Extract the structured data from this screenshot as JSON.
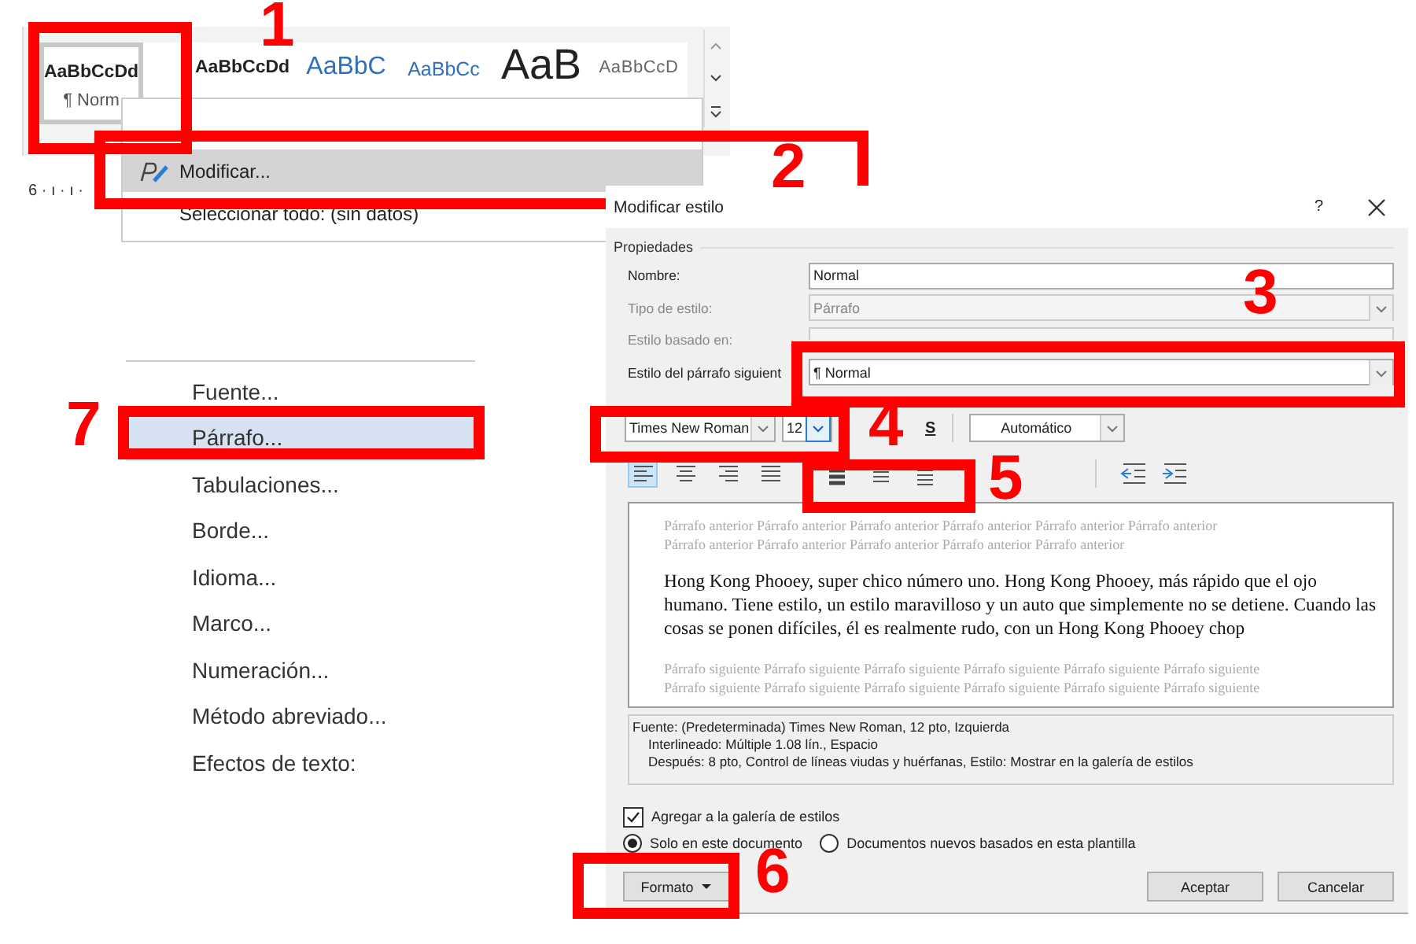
{
  "ribbon": {
    "styles": [
      {
        "preview": "AaBbCcDd",
        "kind": "normal",
        "selected": true,
        "label": "¶ Norm"
      },
      {
        "preview": "AaBbCcDd",
        "kind": "normal",
        "selected": false
      },
      {
        "preview": "AaBbC",
        "kind": "heading1",
        "selected": false
      },
      {
        "preview": "AaBbCc",
        "kind": "heading2",
        "selected": false
      },
      {
        "preview": "AaB",
        "kind": "title",
        "selected": false
      },
      {
        "preview": "AaBbCcD",
        "kind": "subtitle",
        "selected": false
      }
    ],
    "ruler": "6 · ı · ı ·"
  },
  "context_menu": {
    "items": [
      {
        "label": "Modificar...",
        "kind": "modify",
        "selected": true
      },
      {
        "label": "Seleccionar todo: (sin datos)",
        "kind": "plain",
        "selected": false
      }
    ]
  },
  "format_menu": {
    "items": [
      {
        "label": "Fuente...",
        "selected": false
      },
      {
        "label": "Párrafo...",
        "selected": true
      },
      {
        "label": "Tabulaciones...",
        "selected": false
      },
      {
        "label": "Borde...",
        "selected": false
      },
      {
        "label": "Idioma...",
        "selected": false
      },
      {
        "label": "Marco...",
        "selected": false
      },
      {
        "label": "Numeración...",
        "selected": false
      },
      {
        "label": "Método abreviado...",
        "selected": false
      },
      {
        "label": "Efectos de texto:",
        "selected": false
      }
    ]
  },
  "dialog": {
    "title": "Modificar estilo",
    "help": "?",
    "section": "Propiedades",
    "fields": [
      {
        "label": "Nombre:",
        "value": "Normal",
        "kind": "text",
        "disabled": false
      },
      {
        "label": "Tipo de estilo:",
        "value": "Párrafo",
        "kind": "select",
        "disabled": true
      },
      {
        "label": "Estilo basado en:",
        "kind": "select",
        "disabled": true
      },
      {
        "label": "Estilo del párrafo siguient",
        "value": "¶ Normal",
        "kind": "select",
        "disabled": false
      }
    ],
    "font": "Times New Roman",
    "size": "12",
    "underline": "S",
    "text_color": "Automático",
    "alignment": [
      {
        "kind": "left",
        "selected": true
      },
      {
        "kind": "center",
        "selected": false
      },
      {
        "kind": "right",
        "selected": false
      },
      {
        "kind": "justify",
        "selected": false
      }
    ],
    "preview": {
      "previous": [
        "Párrafo anterior Párrafo anterior Párrafo anterior Párrafo anterior Párrafo anterior Párrafo anterior",
        "Párrafo anterior Párrafo anterior Párrafo anterior Párrafo anterior Párrafo anterior"
      ],
      "sample": "Hong Kong Phooey, super chico número uno. Hong Kong Phooey, más rápido que el ojo humano. Tiene estilo, un estilo maravilloso y un auto que simplemente no se detiene. Cuando las cosas se ponen difíciles, él es realmente rudo, con un Hong Kong Phooey chop",
      "next": [
        "Párrafo siguiente Párrafo siguiente Párrafo siguiente Párrafo siguiente Párrafo siguiente Párrafo siguiente",
        "Párrafo siguiente Párrafo siguiente Párrafo siguiente Párrafo siguiente Párrafo siguiente Párrafo siguiente"
      ]
    },
    "description": [
      "Fuente: (Predeterminada) Times New Roman, 12 pto, Izquierda",
      "Interlineado:  Múltiple 1.08 lín., Espacio",
      "Después:  8 pto, Control de líneas viudas y huérfanas, Estilo: Mostrar en la galería de estilos"
    ],
    "gallery_checkbox": {
      "label": "Agregar a la galería de estilos",
      "checked": true
    },
    "scope": [
      {
        "label": "Solo en este documento",
        "selected": true
      },
      {
        "label": "Documentos nuevos basados en esta plantilla",
        "selected": false
      }
    ],
    "buttons": {
      "format": "Formato",
      "ok": "Aceptar",
      "cancel": "Cancelar"
    }
  },
  "callouts": [
    {
      "number": "1"
    },
    {
      "number": "2"
    },
    {
      "number": "3"
    },
    {
      "number": "4"
    },
    {
      "number": "5"
    },
    {
      "number": "6"
    },
    {
      "number": "7"
    }
  ]
}
